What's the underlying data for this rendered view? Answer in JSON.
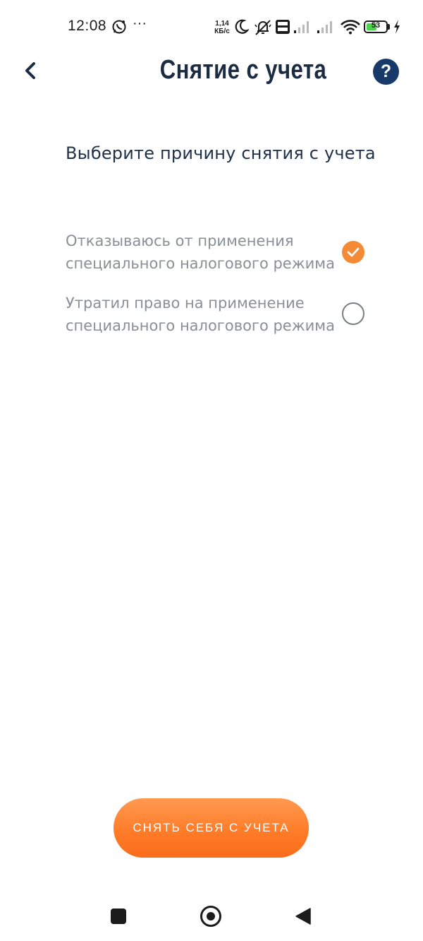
{
  "status_bar": {
    "time": "12:08",
    "dots": "···",
    "net_speed_value": "1,14",
    "net_speed_unit": "КБ/с",
    "battery_level": "53",
    "battery_percent": 53,
    "icons": [
      "whatsapp-icon",
      "moon-icon",
      "silent-bell-icon",
      "volte-icon",
      "signal-icon",
      "signal-icon",
      "wifi-icon",
      "battery-icon",
      "charging-icon"
    ]
  },
  "header": {
    "title": "Снятие с учета",
    "back_icon": "chevron-left-icon",
    "help_label": "?"
  },
  "main": {
    "subtitle": "Выберите причину снятия с учета",
    "options": [
      {
        "label": "Отказываюсь от применения специального налогового режима",
        "selected": true
      },
      {
        "label": "Утратил право на применение специального налогового режима",
        "selected": false
      }
    ],
    "button_label": "СНЯТЬ СЕБЯ С УЧЕТА"
  },
  "colors": {
    "accent": "#f48a35",
    "title": "#1a2b44",
    "help_bg": "#183a6a",
    "option_text": "#8a8f96"
  },
  "nav_bar": {
    "icons": [
      "recents-icon",
      "home-icon",
      "back-triangle-icon"
    ]
  }
}
